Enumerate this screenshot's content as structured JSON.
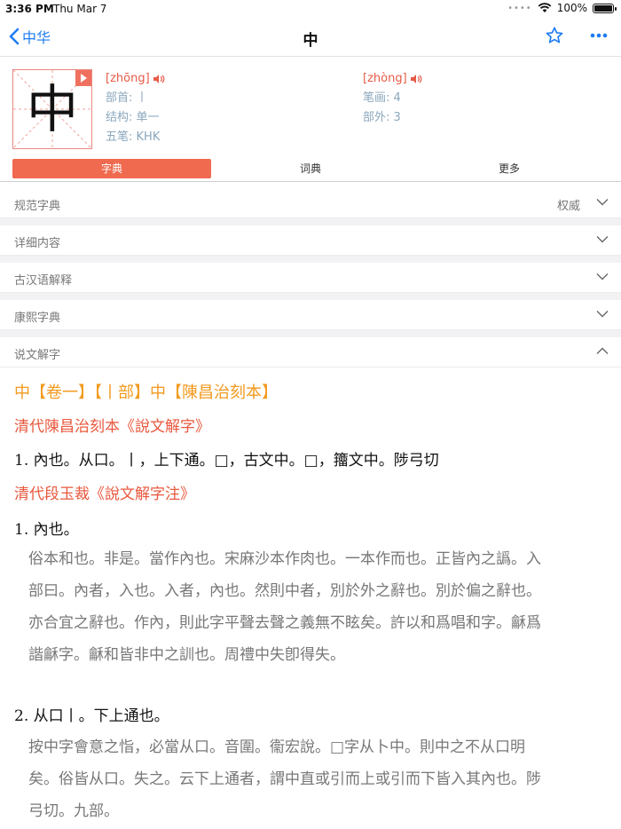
{
  "status_bar": {
    "time": "3:36 PM",
    "date": "Thu Mar 7",
    "battery": "100%",
    "battery_level": 1.0,
    "icons": [
      "cellular-dots-icon",
      "wifi-icon",
      "battery-icon"
    ]
  },
  "nav": {
    "back_label": "中华",
    "title": "中",
    "icons": [
      "chevron-left-icon",
      "star-icon",
      "more-icon"
    ],
    "accent_color": "#1e7cf2"
  },
  "character": {
    "glyph": "中",
    "pinyin_1": "[zhōng]",
    "pinyin_2": "[zhòng]",
    "radical": "部首: 丨",
    "strokes": "笔画: 4",
    "structure": "结构: 单一",
    "outside_strokes": "部外: 3",
    "wubi": "五笔: KHK"
  },
  "tabs": {
    "items": [
      "字典",
      "词典",
      "更多"
    ],
    "active": "字典",
    "active_color": "#f06a50"
  },
  "sections": [
    {
      "label": "规范字典",
      "tag": "权威",
      "expanded": false
    },
    {
      "label": "详细内容",
      "tag": "",
      "expanded": false
    },
    {
      "label": "古汉语解释",
      "tag": "",
      "expanded": false
    },
    {
      "label": "康熙字典",
      "tag": "",
      "expanded": false
    },
    {
      "label": "说文解字",
      "tag": "",
      "expanded": true
    }
  ],
  "shuowen": {
    "heading": "中【卷一】【丨部】中【陳昌治刻本】",
    "source_1": "清代陳昌治刻本《說文解字》",
    "def_1": "1. 內也。从口。丨，上下通。□，古文中。□，籒文中。陟弓切",
    "source_2": "清代段玉裁《說文解字注》",
    "def_2": "1. 內也。",
    "note_2": [
      "俗本和也。非是。當作內也。宋麻沙本作肉也。一本作而也。正皆內之譌。入",
      "部曰。內者，入也。入者，內也。然則中者，別於外之辭也。別於偏之辭也。",
      "亦合宜之辭也。作內，則此字平聲去聲之義無不眩矣。許以和爲唱和字。龢爲",
      "諧龢字。龢和皆非中之訓也。周禮中失卽得失。"
    ],
    "def_3": "2. 从口丨。下上通也。",
    "note_3": [
      "按中字會意之恉，必當从口。音圍。衞宏說。□字从卜中。則中之不从口明",
      "矣。俗皆从口。失之。云下上通者，謂中直或引而上或引而下皆入其內也。陟",
      "弓切。九部。"
    ]
  }
}
